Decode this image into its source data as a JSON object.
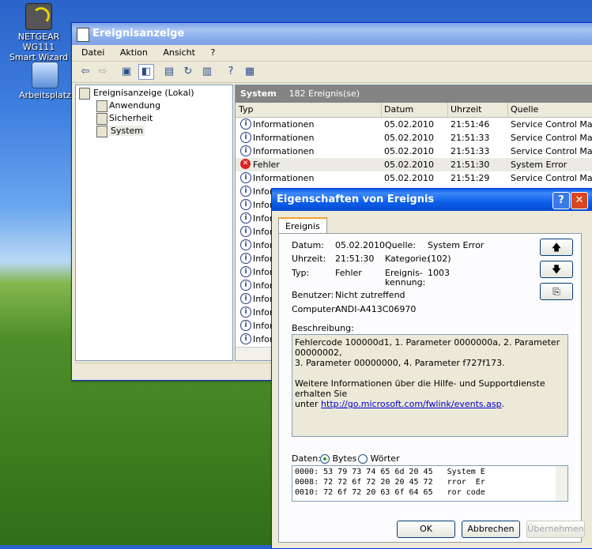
{
  "desktop": {
    "netgear_label_line1": "NETGEAR WG111",
    "netgear_label_line2": "Smart Wizard",
    "computer_label": "Arbeitsplatz"
  },
  "window": {
    "title": "Ereignisanzeige",
    "menu": [
      "Datei",
      "Aktion",
      "Ansicht",
      "?"
    ],
    "tree": {
      "root": "Ereignisanzeige (Lokal)",
      "children": [
        "Anwendung",
        "Sicherheit",
        "System"
      ]
    },
    "list": {
      "title": "System",
      "count": "182 Ereignis(se)",
      "columns": [
        "Typ",
        "Datum",
        "Uhrzeit",
        "Quelle"
      ],
      "rows": [
        {
          "type": "Informationen",
          "date": "05.02.2010",
          "time": "21:51:46",
          "source": "Service Control Mana"
        },
        {
          "type": "Informationen",
          "date": "05.02.2010",
          "time": "21:51:33",
          "source": "Service Control Mana"
        },
        {
          "type": "Informationen",
          "date": "05.02.2010",
          "time": "21:51:33",
          "source": "Service Control Mana"
        },
        {
          "type": "Fehler",
          "date": "05.02.2010",
          "time": "21:51:30",
          "source": "System Error"
        },
        {
          "type": "Informationen",
          "date": "05.02.2010",
          "time": "21:51:29",
          "source": "Service Control Mana"
        }
      ],
      "truncated_rows": [
        "Infor",
        "Infor",
        "Infor",
        "Infor",
        "Infor",
        "Infor",
        "Infor",
        "Infor",
        "Infor",
        "Infor",
        "Infor",
        "Infor"
      ]
    }
  },
  "dialog": {
    "title": "Eigenschaften von Ereignis",
    "help_glyph": "?",
    "close_glyph": "✕",
    "tab": "Ereignis",
    "fields": {
      "datum_label": "Datum:",
      "datum_value": "05.02.2010",
      "quelle_label": "Quelle:",
      "quelle_value": "System Error",
      "uhrzeit_label": "Uhrzeit:",
      "uhrzeit_value": "21:51:30",
      "kategorie_label": "Kategorie:",
      "kategorie_value": "(102)",
      "typ_label": "Typ:",
      "typ_value": "Fehler",
      "kennung_label_1": "Ereignis-",
      "kennung_label_2": "kennung:",
      "kennung_value": "1003",
      "benutzer_label": "Benutzer:",
      "benutzer_value": "Nicht zutreffend",
      "computer_label": "Computer:",
      "computer_value": "ANDI-A413C06970"
    },
    "beschreibung_label": "Beschreibung:",
    "description_line1": "Fehlercode 100000d1, 1. Parameter 0000000a, 2. Parameter 00000002,",
    "description_line2": "3. Parameter 00000000, 4. Parameter f727f173.",
    "description_line3": "Weitere Informationen über die Hilfe- und Supportdienste erhalten Sie",
    "description_line4_prefix": "unter ",
    "description_link": "http://go.microsoft.com/fwlink/events.asp",
    "description_line4_suffix": ".",
    "daten_label": "Daten:",
    "bytes_label": "Bytes",
    "woerter_label": "Wörter",
    "hex_lines": [
      "0000: 53 79 73 74 65 6d 20 45   System E",
      "0008: 72 72 6f 72 20 20 45 72   rror  Er",
      "0010: 72 6f 72 20 63 6f 64 65   ror code"
    ],
    "buttons": {
      "ok": "OK",
      "cancel": "Abbrechen",
      "apply": "Übernehmen"
    }
  }
}
